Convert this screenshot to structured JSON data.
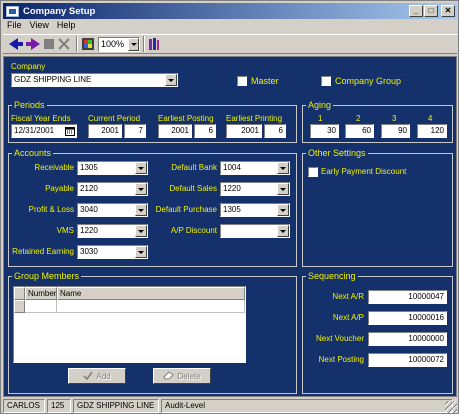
{
  "window": {
    "title": "Company Setup"
  },
  "menu": [
    "File",
    "View",
    "Help"
  ],
  "toolbar": {
    "zoom": "100%"
  },
  "company": {
    "label": "Company",
    "value": "GDZ SHIPPING LINE",
    "master_label": "Master",
    "master_checked": false,
    "company_group_label": "Company Group",
    "company_group_checked": false
  },
  "periods": {
    "title": "Periods",
    "fiscal_year_ends_label": "Fiscal Year Ends",
    "fiscal_year_ends": "12/31/2001",
    "current_period_label": "Current Period",
    "current_period_year": "2001",
    "current_period_num": "7",
    "earliest_posting_label": "Earliest Posting",
    "earliest_posting_year": "2001",
    "earliest_posting_num": "6",
    "earliest_printing_label": "Earliest Printing",
    "earliest_printing_year": "2001",
    "earliest_printing_num": "6"
  },
  "aging": {
    "title": "Aging",
    "headers": [
      "1",
      "2",
      "3",
      "4"
    ],
    "values": [
      "30",
      "60",
      "90",
      "120"
    ]
  },
  "accounts": {
    "title": "Accounts",
    "receivable_label": "Receivable",
    "receivable": "1305",
    "payable_label": "Payable",
    "payable": "2120",
    "profit_loss_label": "Profit & Loss",
    "profit_loss": "3040",
    "vms_label": "VMS",
    "vms": "1220",
    "retained_earning_label": "Retained Earning",
    "retained_earning": "3030",
    "default_bank_label": "Default Bank",
    "default_bank": "1004",
    "default_sales_label": "Default Sales",
    "default_sales": "1220",
    "default_purchase_label": "Default Purchase",
    "default_purchase": "1305",
    "ap_discount_label": "A/P Discount",
    "ap_discount": ""
  },
  "other_settings": {
    "title": "Other Settings",
    "early_payment_label": "Early Payment Discount",
    "early_payment_checked": false
  },
  "group_members": {
    "title": "Group Members",
    "col_number": "Number",
    "col_name": "Name",
    "add_label": "Add",
    "delete_label": "Delete"
  },
  "sequencing": {
    "title": "Sequencing",
    "next_ar_label": "Next A/R",
    "next_ar": "10000047",
    "next_ap_label": "Next A/P",
    "next_ap": "10000016",
    "next_voucher_label": "Next Voucher",
    "next_voucher": "10000000",
    "next_posting_label": "Next Posting",
    "next_posting": "10000072"
  },
  "status": {
    "user": "CARLOS",
    "company_code": "125",
    "company_name": "GDZ SHIPPING LINE",
    "level": "Audit-Level"
  },
  "colors": {
    "panel_bg": "#14316b",
    "label": "#f2f200",
    "title_start": "#0a246a",
    "title_end": "#a6caf0"
  }
}
